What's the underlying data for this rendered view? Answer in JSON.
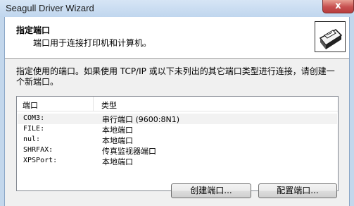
{
  "window": {
    "title": "Seagull Driver Wizard",
    "close_label": "x"
  },
  "header": {
    "title": "指定端口",
    "subtitle": "端口用于连接打印机和计算机。"
  },
  "instruction": "指定使用的端口。如果使用 TCP/IP 或以下未列出的其它端口类型进行连接，请创建一个新端口。",
  "port_list": {
    "columns": {
      "port": "端口",
      "type": "类型"
    },
    "rows": [
      {
        "port": "COM3:",
        "type": "串行端口 (9600:8N1)",
        "selected": true
      },
      {
        "port": "FILE:",
        "type": "本地端口"
      },
      {
        "port": "nul:",
        "type": "本地端口"
      },
      {
        "port": "SHRFAX:",
        "type": "传真监视器端口"
      },
      {
        "port": "XPSPort:",
        "type": "本地端口"
      }
    ]
  },
  "buttons": {
    "create": "创建端口...",
    "configure": "配置端口..."
  },
  "icons": {
    "header": "printer-icon",
    "close": "close-icon"
  }
}
